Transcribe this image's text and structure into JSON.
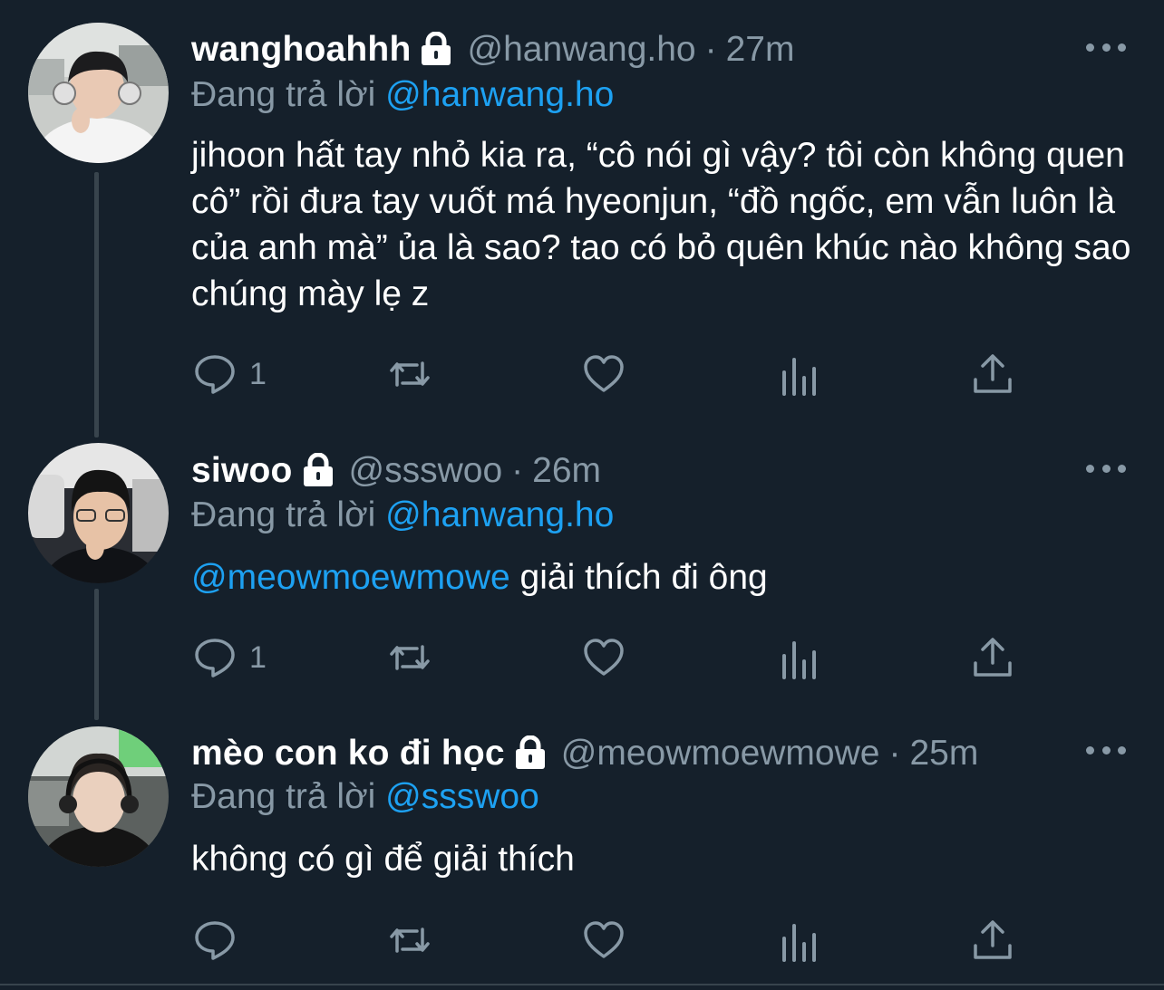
{
  "reply_prefix": "Đang trả lời",
  "tweets": [
    {
      "name": "wanghoahhh",
      "handle": "@hanwang.ho",
      "separator": "·",
      "time": "27m",
      "replying_to": "@hanwang.ho",
      "body": "jihoon hất tay nhỏ kia ra, “cô nói gì vậy? tôi còn không quen cô” rồi đưa tay vuốt má hyeonjun, “đồ ngốc, em vẫn luôn là của anh mà” ủa là sao? tao có bỏ quên khúc nào không sao chúng mày lẹ z",
      "reply_count": "1"
    },
    {
      "name": "siwoo",
      "handle": "@ssswoo",
      "separator": "·",
      "time": "26m",
      "replying_to": "@hanwang.ho",
      "body_mention": "@meowmoewmowe",
      "body": " giải thích đi ông",
      "reply_count": "1"
    },
    {
      "name": "mèo con ko đi học",
      "handle": "@meowmoewmowe",
      "separator": "·",
      "time": "25m",
      "replying_to": "@ssswoo",
      "body": "không có gì để giải thích",
      "reply_count": ""
    }
  ],
  "icons": {
    "reply": "reply-icon",
    "retweet": "retweet-icon",
    "like": "heart-icon",
    "analytics": "analytics-icon",
    "share": "share-icon",
    "lock": "lock-icon",
    "more": "more-icon"
  },
  "colors": {
    "background": "#15202b",
    "secondary_text": "#8899a6",
    "link": "#1da1f2",
    "divider": "#38444d"
  }
}
